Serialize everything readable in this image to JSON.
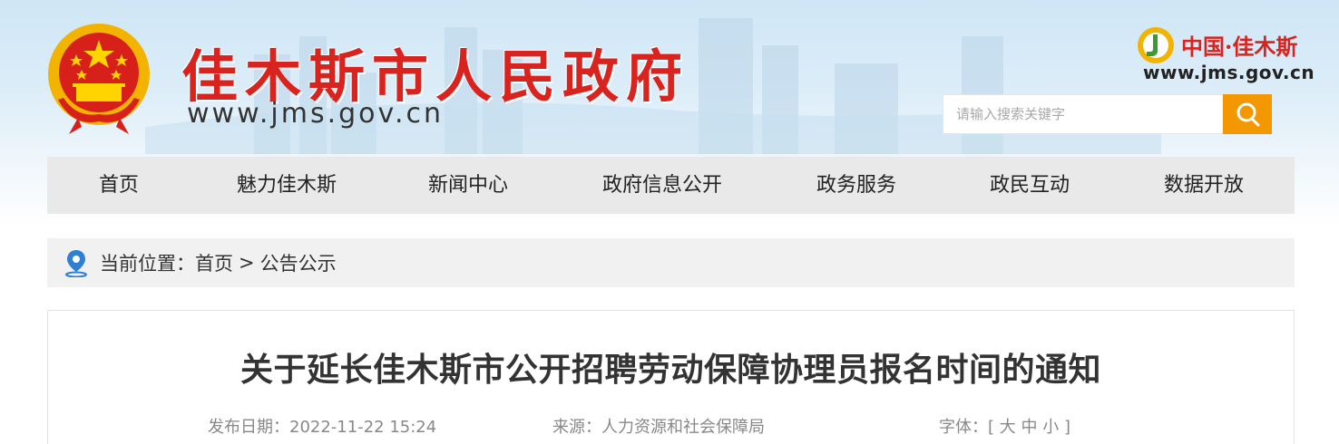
{
  "header": {
    "site_title": "佳木斯市人民政府",
    "site_url": "www.jms.gov.cn",
    "brand_cn": "中国·佳木斯",
    "brand_url": "www.jms.gov.cn",
    "search_placeholder": "请输入搜索关键字"
  },
  "nav": {
    "items": [
      {
        "label": "首页"
      },
      {
        "label": "魅力佳木斯"
      },
      {
        "label": "新闻中心"
      },
      {
        "label": "政府信息公开"
      },
      {
        "label": "政务服务"
      },
      {
        "label": "政民互动"
      },
      {
        "label": "数据开放"
      }
    ]
  },
  "breadcrumb": {
    "prefix": "当前位置：",
    "home": "首页",
    "separator": ">",
    "current": "公告公示"
  },
  "article": {
    "title": "关于延长佳木斯市公开招聘劳动保障协理员报名时间的通知",
    "publish_date": "发布日期：2022-11-22 15:24",
    "source": "来源：人力资源和社会保障局",
    "font_label": "字体：[",
    "font_large": "大",
    "font_medium": "中",
    "font_small": "小",
    "font_close": "]"
  },
  "colors": {
    "title_red": "#d8231e",
    "search_orange": "#f39800",
    "nav_bg": "#e9e9e9",
    "crumb_bg": "#f1f1f1",
    "pin_blue": "#2f7fd2"
  },
  "icons": {
    "emblem": "national-emblem-icon",
    "search": "search-icon",
    "location": "location-pin-icon",
    "brand": "jms-brand-logo-icon"
  }
}
